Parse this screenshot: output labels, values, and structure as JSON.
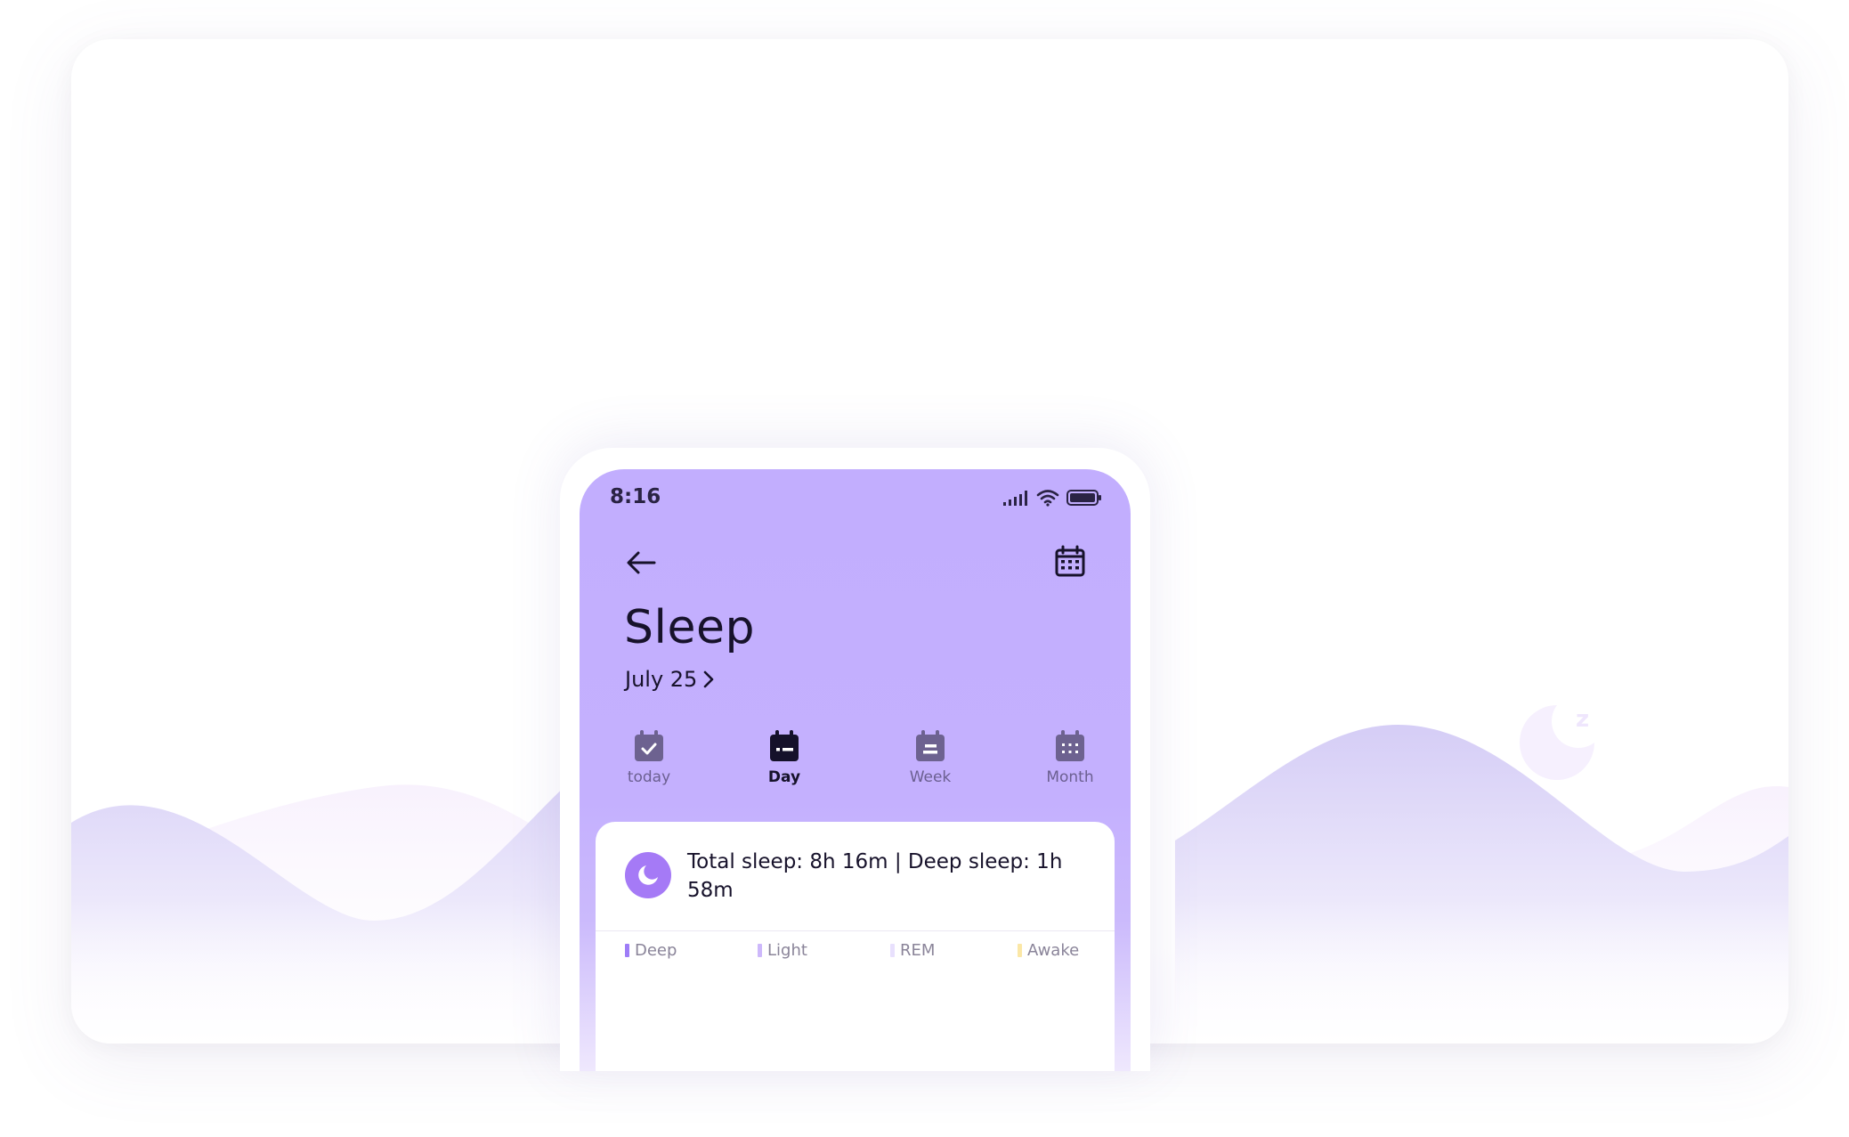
{
  "status_bar": {
    "time": "8:16"
  },
  "header": {
    "title": "Sleep",
    "date": "July 25"
  },
  "tabs": [
    {
      "label": "today",
      "icon": "calendar-check-icon",
      "active": false
    },
    {
      "label": "Day",
      "icon": "calendar-day-icon",
      "active": true
    },
    {
      "label": "Week",
      "icon": "calendar-week-icon",
      "active": false
    },
    {
      "label": "Month",
      "icon": "calendar-month-icon",
      "active": false
    }
  ],
  "summary": {
    "text": "Total sleep: 8h 16m | Deep sleep: 1h 58m",
    "icon": "moon-icon"
  },
  "legend": [
    {
      "label": "Deep",
      "color": "#9e7df7"
    },
    {
      "label": "Light",
      "color": "#cdb8fb"
    },
    {
      "label": "REM",
      "color": "#e8e0fd"
    },
    {
      "label": "Awake",
      "color": "#fbe7a6"
    }
  ],
  "colors": {
    "header_bg": "#c2aefe",
    "accent": "#a57af6",
    "text_dark": "#17122b"
  }
}
